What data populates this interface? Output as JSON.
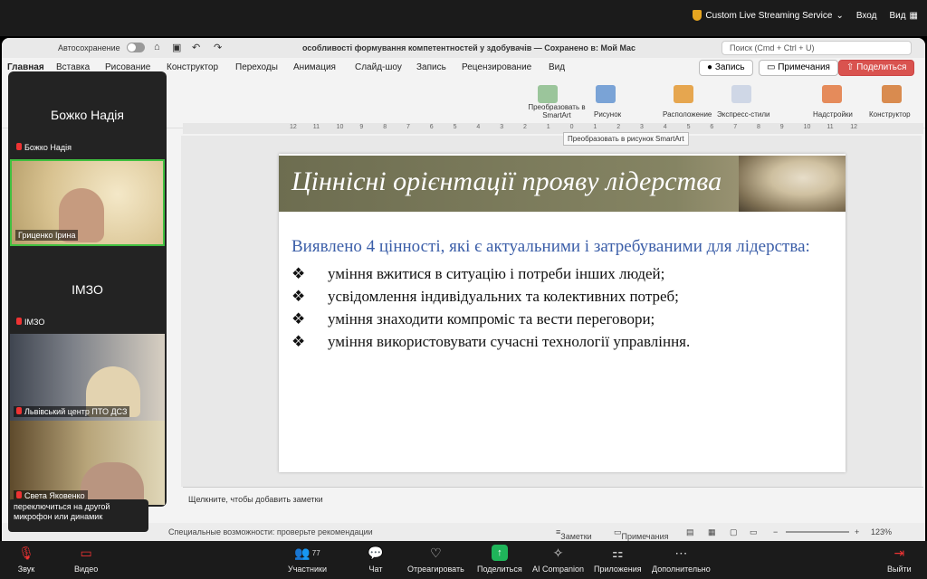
{
  "zoom_top": {
    "streaming": "Custom Live Streaming Service",
    "login": "Вход",
    "view": "Вид"
  },
  "ppt": {
    "autosave": "Автосохранение",
    "doc_title": "особливості формування компетентностей у здобувачів — Сохранено в: Мой Mac",
    "search": "Поиск (Cmd + Ctrl + U)",
    "tabs": [
      "Главная",
      "Вставка",
      "Рисование",
      "Конструктор",
      "Переходы",
      "Анимация",
      "Слайд-шоу",
      "Запись",
      "Рецензирование",
      "Вид"
    ],
    "record_btn": "Запись",
    "comments_btn": "Примечания",
    "share_btn": "Поделиться",
    "ribbon": {
      "smartart": "Преобразовать в SmartArt",
      "picture": "Рисунок",
      "arrange": "Расположение",
      "quick_styles": "Экспресс-стили",
      "addins": "Надстройки",
      "designer": "Конструктор"
    },
    "tooltip": "Преобразовать в рисунок SmartArt",
    "ruler_ticks": [
      "12",
      "11",
      "10",
      "9",
      "8",
      "7",
      "6",
      "5",
      "4",
      "3",
      "2",
      "1",
      "0",
      "1",
      "2",
      "3",
      "4",
      "5",
      "6",
      "7",
      "8",
      "9",
      "10",
      "11",
      "12"
    ],
    "slide": {
      "title": "Ціннісні орієнтації прояву лідерства",
      "lead": "Виявлено 4 цінності, які є актуальними і затребуваними для лідерства:",
      "bullets": [
        "уміння вжитися в ситуацію і потреби інших людей;",
        "усвідомлення індивідуальних та колективних потреб;",
        "уміння знаходити компроміс та вести переговори;",
        "уміння використовувати сучасні технології управління."
      ]
    },
    "notes": "Щелкните, чтобы добавить заметки",
    "status": {
      "accessibility": "Специальные возможности: проверьте рекомендации",
      "notes": "Заметки",
      "comments": "Примечания",
      "zoom": "123%"
    }
  },
  "participants": [
    {
      "name": "Божко Надія",
      "big": "Божко Надія"
    },
    {
      "name": "Гриценко Ірина",
      "big": ""
    },
    {
      "name": "ІМЗО",
      "big": "ІМЗО"
    },
    {
      "name": "Львівський центр ПТО ДСЗ",
      "big": ""
    },
    {
      "name": "Света Яковенко",
      "big": ""
    }
  ],
  "caption": "переключиться на другой микрофон или динамик",
  "zoom_bottom": {
    "audio": "Звук",
    "video": "Видео",
    "participants": "Участники",
    "participants_count": "77",
    "chat": "Чат",
    "react": "Отреагировать",
    "share": "Поделиться",
    "ai": "AI Companion",
    "apps": "Приложения",
    "more": "Дополнительно",
    "leave": "Выйти"
  }
}
